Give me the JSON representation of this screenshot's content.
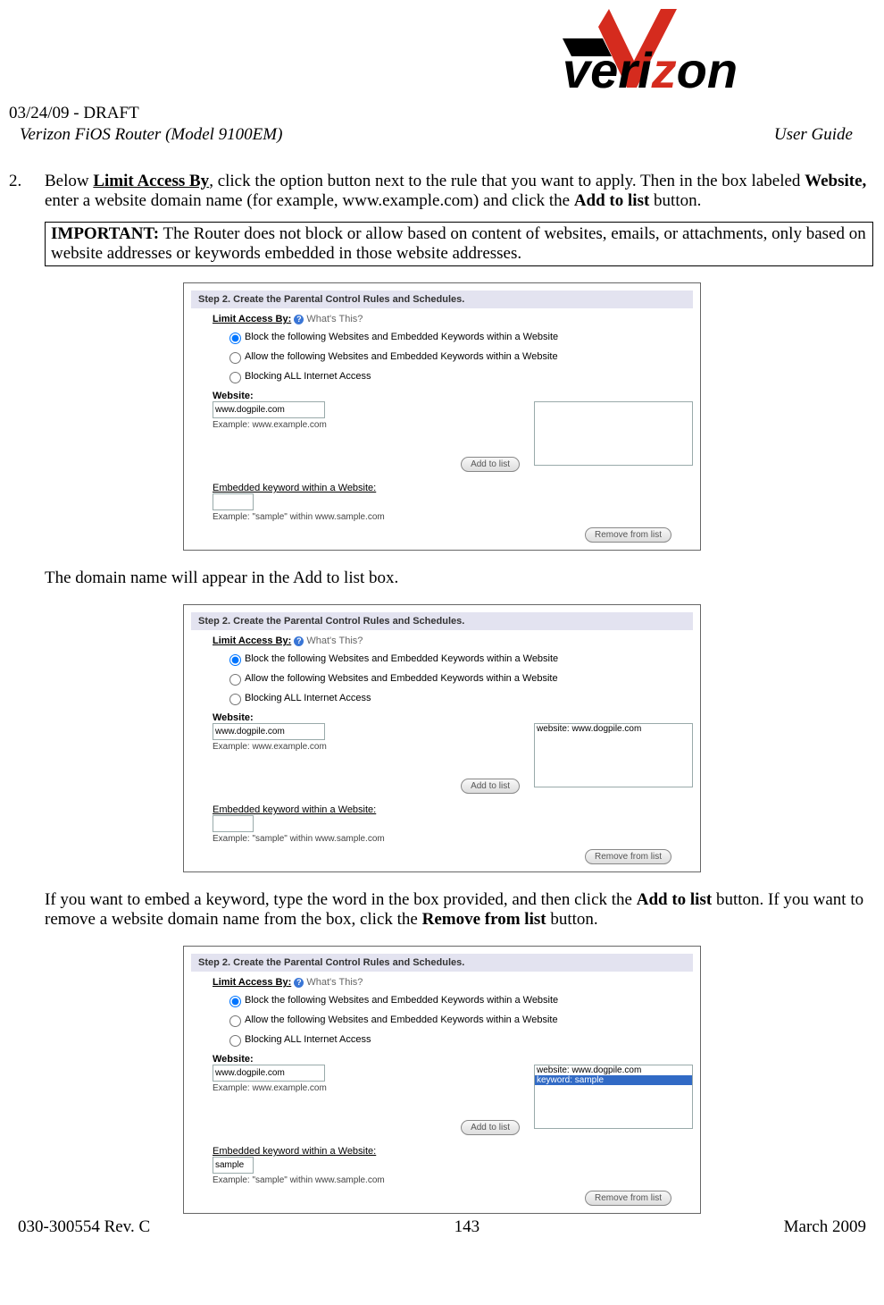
{
  "header": {
    "draft": "03/24/09 - DRAFT",
    "titleLeft": "Verizon FiOS Router (Model 9100EM)",
    "titleRight": "User Guide"
  },
  "logo": {
    "brand_pre": "veri",
    "brand_post": "on",
    "brand_z": "z"
  },
  "step": {
    "num": "2.",
    "t1": "Below ",
    "boldU1": "Limit Access By",
    "t2": ", click the option button next to the rule that you want to apply. Then in the box labeled ",
    "bold1": "Website,",
    "t3": " enter a website domain name (for example, www.example.com) and click the ",
    "bold2": "Add to list",
    "t4": " button."
  },
  "important": {
    "label": "IMPORTANT:",
    "text": " The Router does not block or allow based on content of websites, emails, or attachments, only based on website addresses or keywords embedded in those website addresses."
  },
  "sc": {
    "stepbar": "Step 2. Create the Parental Control Rules and Schedules.",
    "limit": "Limit Access By:",
    "whats": "What's This?",
    "r1": "Block the following Websites and Embedded Keywords within a Website",
    "r2": "Allow the following Websites and Embedded Keywords within a Website",
    "r3": "Blocking ALL Internet Access",
    "websiteLabel": "Website:",
    "websiteVal": "www.dogpile.com",
    "websiteEx": "Example: www.example.com",
    "addBtn": "Add to list",
    "embLabel": "Embedded keyword within a Website:",
    "embVal": "",
    "embVal3": "sample",
    "embEx": "Example: \"sample\" within www.sample.com",
    "removeBtn": "Remove from list",
    "listItem1": "website: www.dogpile.com",
    "listItem2": "keyword: sample"
  },
  "para2": "The domain name will appear in the Add to list box.",
  "para3": {
    "t1": "If you want to embed a keyword, type the word in the box provided, and then click the ",
    "b1": "Add to list",
    "t2": " button. If you want to remove a website domain name from the box, click the ",
    "b2": "Remove from list",
    "t3": " button."
  },
  "footer": {
    "left": "030-300554 Rev. C",
    "center": "143",
    "right": "March 2009"
  }
}
